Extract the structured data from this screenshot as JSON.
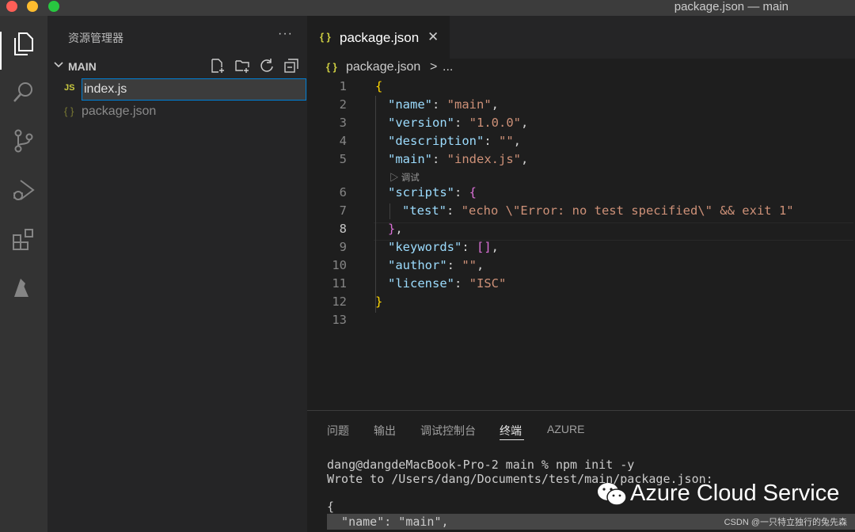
{
  "window": {
    "title": "package.json — main"
  },
  "activity_bar": {
    "icons": [
      "files-icon",
      "search-icon",
      "source-control-icon",
      "run-debug-icon",
      "extensions-icon",
      "azure-icon"
    ]
  },
  "sidebar": {
    "title": "资源管理器",
    "more": "···",
    "section": "MAIN",
    "files": [
      {
        "icon_text": "JS",
        "name": "index.js"
      },
      {
        "icon_text": "{ }",
        "name": "package.json"
      }
    ]
  },
  "editor": {
    "tab": {
      "icon_text": "{ }",
      "label": "package.json",
      "close": "✕"
    },
    "breadcrumb": {
      "icon_text": "{ }",
      "file": "package.json",
      "sep": ">",
      "more": "..."
    },
    "codelens": "▷ 调试",
    "line_numbers": [
      "1",
      "2",
      "3",
      "4",
      "5",
      "6",
      "7",
      "8",
      "9",
      "10",
      "11",
      "12",
      "13"
    ],
    "lines": {
      "l1": "{",
      "l2_key": "\"name\"",
      "l2_val": "\"main\"",
      "l3_key": "\"version\"",
      "l3_val": "\"1.0.0\"",
      "l4_key": "\"description\"",
      "l4_val": "\"\"",
      "l5_key": "\"main\"",
      "l5_val": "\"index.js\"",
      "l6_key": "\"scripts\"",
      "l6_brace": "{",
      "l7_key": "\"test\"",
      "l7_val": "\"echo \\\"Error: no test specified\\\" && exit 1\"",
      "l8_brace": "}",
      "l9_key": "\"keywords\"",
      "l9_val": "[]",
      "l10_key": "\"author\"",
      "l10_val": "\"\"",
      "l11_key": "\"license\"",
      "l11_val": "\"ISC\"",
      "l12": "}",
      "colon": ": ",
      "comma": ","
    }
  },
  "panel": {
    "tabs": [
      "问题",
      "输出",
      "调试控制台",
      "终端",
      "AZURE"
    ],
    "active_tab": "终端",
    "terminal_lines": [
      "dang@dangdeMacBook-Pro-2 main % npm init -y",
      "Wrote to /Users/dang/Documents/test/main/package.json:",
      "",
      "{",
      "  \"name\": \"main\","
    ]
  },
  "watermark": {
    "text": "Azure Cloud Service",
    "credit": "CSDN @一只特立独行的兔先森"
  }
}
